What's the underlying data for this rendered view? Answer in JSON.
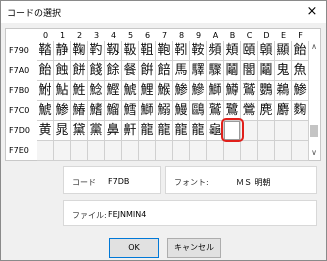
{
  "window": {
    "title": "コードの選択",
    "close_icon": "×"
  },
  "grid": {
    "columns": [
      "0",
      "1",
      "2",
      "3",
      "4",
      "5",
      "6",
      "7",
      "8",
      "9",
      "A",
      "B",
      "C",
      "D",
      "E",
      "F"
    ],
    "rows": [
      {
        "code": "F790",
        "chars": [
          "鞜",
          "静",
          "鞠",
          "靮",
          "靱",
          "靸",
          "靻",
          "鞄",
          "靷",
          "鞍",
          "頻",
          "頬",
          "頤",
          "顊",
          "顯",
          "飴"
        ]
      },
      {
        "code": "F7A0",
        "chars": [
          "飴",
          "蝕",
          "餅",
          "餞",
          "餘",
          "餐",
          "餠",
          "餢",
          "馬",
          "驛",
          "驟",
          "鬮",
          "闇",
          "鬮",
          "鬼",
          "魚"
        ]
      },
      {
        "code": "F7B0",
        "chars": [
          "鮒",
          "鮎",
          "鮏",
          "鯰",
          "鰹",
          "鯱",
          "鯉",
          "鯸",
          "鯵",
          "鰺",
          "鰤",
          "鱒",
          "鷲",
          "鸚",
          "鵜",
          "鯵"
        ]
      },
      {
        "code": "F7C0",
        "chars": [
          "鯱",
          "鯵",
          "鰆",
          "鰭",
          "鰡",
          "鱈",
          "鰤",
          "鰯",
          "鰻",
          "鷗",
          "鷲",
          "鷺",
          "鶯",
          "麂",
          "麝",
          "麴"
        ]
      },
      {
        "code": "F7D0",
        "chars": [
          "黄",
          "晁",
          "黛",
          "黨",
          "鼻",
          "鼾",
          "龍",
          "龍",
          "龍",
          "龍",
          "龜",
          "",
          "",
          "",
          "",
          ""
        ]
      },
      {
        "code": "F7E0",
        "chars": [
          "",
          "",
          "",
          "",
          "",
          "",
          "",
          "",
          "",
          "",
          "",
          "",
          "",
          "",
          "",
          ""
        ]
      }
    ]
  },
  "scroll": {
    "up_icon": "∧",
    "down_icon": "∨"
  },
  "info": {
    "code_label": "コード",
    "code_value": "F7DB",
    "font_label": "フォント:",
    "font_value": "ＭＳ 明朝",
    "file_label": "ファイル:",
    "file_value": "FEJNMIN4"
  },
  "buttons": {
    "ok": "OK",
    "cancel": "キャンセル"
  },
  "colors": {
    "highlight": "#e0201b",
    "accent": "#0078d7"
  }
}
